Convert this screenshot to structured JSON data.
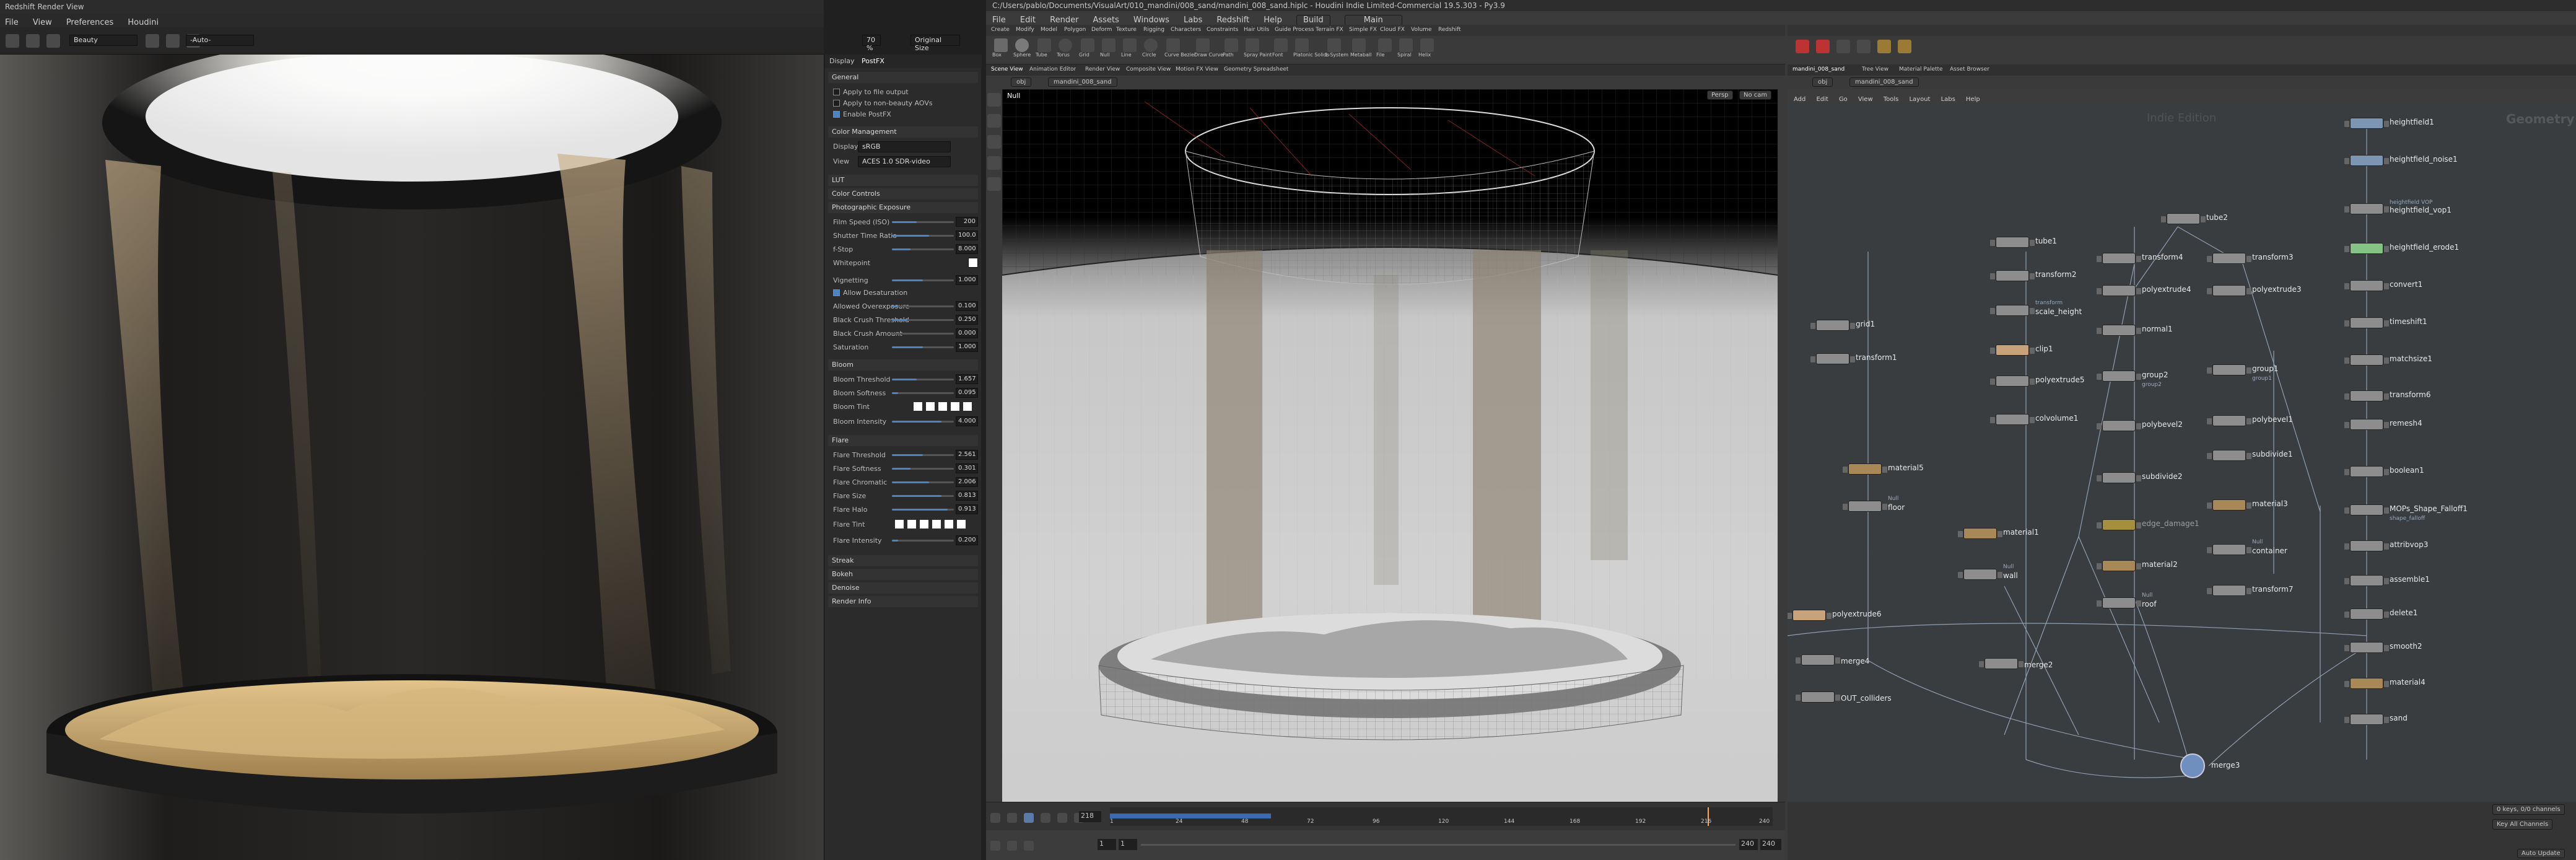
{
  "render_view": {
    "window_title": "Redshift Render View",
    "menu": [
      "File",
      "View",
      "Preferences",
      "Houdini"
    ],
    "aov": "Beauty",
    "camera": "-Auto-",
    "zoom": "70 %",
    "size_mode": "Original Size",
    "panel_tabs": [
      "Display",
      "PostFX"
    ],
    "postfx": {
      "general_header": "General",
      "apply_to_file_output": "Apply to file output",
      "apply_to_non_beauty": "Apply to non-beauty AOVs",
      "enable_postfx": "Enable PostFX",
      "color_mgmt_header": "Color Management",
      "display_label": "Display",
      "display_value": "sRGB",
      "view_label": "View",
      "view_value": "ACES 1.0 SDR-video",
      "lut_header": "LUT",
      "color_controls_header": "Color Controls",
      "photographic_header": "Photographic Exposure",
      "film_speed_label": "Film Speed (ISO)",
      "film_speed": "200",
      "shutter_label": "Shutter Time Ratio",
      "shutter": "100.0",
      "fstop_label": "f-Stop",
      "fstop": "8.000",
      "whitepoint_label": "Whitepoint",
      "vignetting_label": "Vignetting",
      "vignetting": "1.000",
      "allow_desat": "Allow Desaturation",
      "allowed_overexp_label": "Allowed Overexposure",
      "allowed_overexp": "0.100",
      "black_crush_thr_label": "Black Crush Threshold",
      "black_crush_thr": "0.250",
      "black_crush_amt_label": "Black Crush Amount",
      "black_crush_amt": "0.000",
      "saturation_label": "Saturation",
      "saturation": "1.000",
      "bloom_header": "Bloom",
      "bloom_threshold_label": "Bloom Threshold",
      "bloom_threshold": "1.657",
      "bloom_softness_label": "Bloom Softness",
      "bloom_softness": "0.095",
      "bloom_tint_label": "Bloom Tint",
      "bloom_intensity_label": "Bloom Intensity",
      "bloom_intensity": "4.000",
      "flare_header": "Flare",
      "flare_threshold_label": "Flare Threshold",
      "flare_threshold": "2.561",
      "flare_softness_label": "Flare Softness",
      "flare_softness": "0.301",
      "flare_chromatic_label": "Flare Chromatic",
      "flare_chromatic": "2.006",
      "flare_size_label": "Flare Size",
      "flare_size": "0.813",
      "flare_halo_label": "Flare Halo",
      "flare_halo": "0.913",
      "flare_tint_label": "Flare Tint",
      "flare_intensity_label": "Flare Intensity",
      "flare_intensity": "0.200",
      "streak_header": "Streak",
      "bokeh_header": "Bokeh",
      "denoise_header": "Denoise",
      "render_info_header": "Render Info"
    }
  },
  "houdini": {
    "title": "C:/Users/pablo/Documents/VisualArt/010_mandini/008_sand/mandini_008_sand.hiplc - Houdini Indie Limited-Commercial 19.5.303 - Py3.9",
    "menu": [
      "File",
      "Edit",
      "Render",
      "Assets",
      "Windows",
      "Labs",
      "Redshift",
      "Help"
    ],
    "desktop": "Main",
    "build": "Build",
    "shelf_tabs": [
      "Create",
      "Modify",
      "Model",
      "Polygon",
      "Deform",
      "Texture",
      "Rigging",
      "Characters",
      "Constraints",
      "Hair Utils",
      "Guide Process",
      "Terrain FX",
      "Simple FX",
      "Cloud FX",
      "Volume",
      "Redshift"
    ],
    "shelf_tools": [
      "Box",
      "Sphere",
      "Tube",
      "Torus",
      "Grid",
      "Null",
      "Line",
      "Circle",
      "Curve Bezier",
      "Draw Curve",
      "Path",
      "Spray Paint",
      "Font",
      "Platonic Solids",
      "L-System",
      "Metaball",
      "File",
      "Spiral",
      "Helix"
    ],
    "viewport_tabs": [
      "Scene View",
      "Animation Editor",
      "Render View",
      "Composite View",
      "Motion FX View",
      "Geometry Spreadsheet"
    ],
    "path": "obj",
    "node_path": "mandini_008_sand",
    "viewport_label": "Persp",
    "cam_label": "No cam",
    "null_label": "Null",
    "frame": "218",
    "start_frame": "1",
    "start2": "1",
    "end_frame": "240",
    "end2": "240",
    "keys_label": "0 keys, 0/0 channels",
    "key_all": "Key All Channels",
    "auto_update": "Auto Update",
    "net_tabs": [
      "mandini_008_sand",
      "Tree View",
      "Material Palette",
      "Asset Browser"
    ],
    "net_menu": [
      "Add",
      "Edit",
      "Go",
      "View",
      "Tools",
      "Layout",
      "Labs",
      "Help"
    ],
    "watermark_left": "Indie Edition",
    "watermark_right": "Geometry",
    "nodes": {
      "heightfield1": "heightfield1",
      "heightfield_noise1": "heightfield_noise1",
      "heightfield_xop1_sub": "heightfield VOP",
      "heightfield_vop1": "heightfield_vop1",
      "heightfield_erode1": "heightfield_erode1",
      "convert1": "convert1",
      "timeshift1": "timeshift1",
      "matchsize1": "matchsize1",
      "transform6": "transform6",
      "remesh4": "remesh4",
      "boolean1": "boolean1",
      "mops_sub": "shape_falloff",
      "mops": "MOPs_Shape_Falloff1",
      "attribvop3": "attribvop3",
      "assemble1": "assemble1",
      "delete1": "delete1",
      "smooth2": "smooth2",
      "material4": "material4",
      "sand": "sand",
      "merge3": "merge3",
      "tube1": "tube1",
      "tube2": "tube2",
      "transform2": "transform2",
      "transform4": "transform4",
      "transform3": "transform3",
      "polyextrude4": "polyextrude4",
      "polyextrude3": "polyextrude3",
      "scale_height_sub": "transform",
      "scale_height": "scale_height",
      "normal1": "normal1",
      "grid1": "grid1",
      "transform1": "transform1",
      "clip1": "clip1",
      "group2": "group2",
      "group2_sub": "group2",
      "group1": "group1",
      "group1_sub": "group1",
      "polyextrude5": "polyextrude5",
      "colvolume1": "colvolume1",
      "polybevel2": "polybevel2",
      "polybevel1": "polybevel1",
      "subdivide2": "subdivide2",
      "subdivide1": "subdivide1",
      "material5": "material5",
      "floor_sub": "Null",
      "floor": "floor",
      "material1": "material1",
      "edge_damage": "edge_damage1",
      "material3": "material3",
      "wall_sub": "Null",
      "wall": "wall",
      "container_sub": "Null",
      "container": "container",
      "material2": "material2",
      "roof_sub": "Null",
      "roof": "roof",
      "transform7": "transform7",
      "polyextrude6": "polyextrude6",
      "merge4": "merge4",
      "merge2": "merge2",
      "out_colliders": "OUT_colliders"
    }
  },
  "timeline_ticks": [
    "1",
    "24",
    "48",
    "72",
    "96",
    "120",
    "144",
    "168",
    "192",
    "216",
    "240"
  ]
}
